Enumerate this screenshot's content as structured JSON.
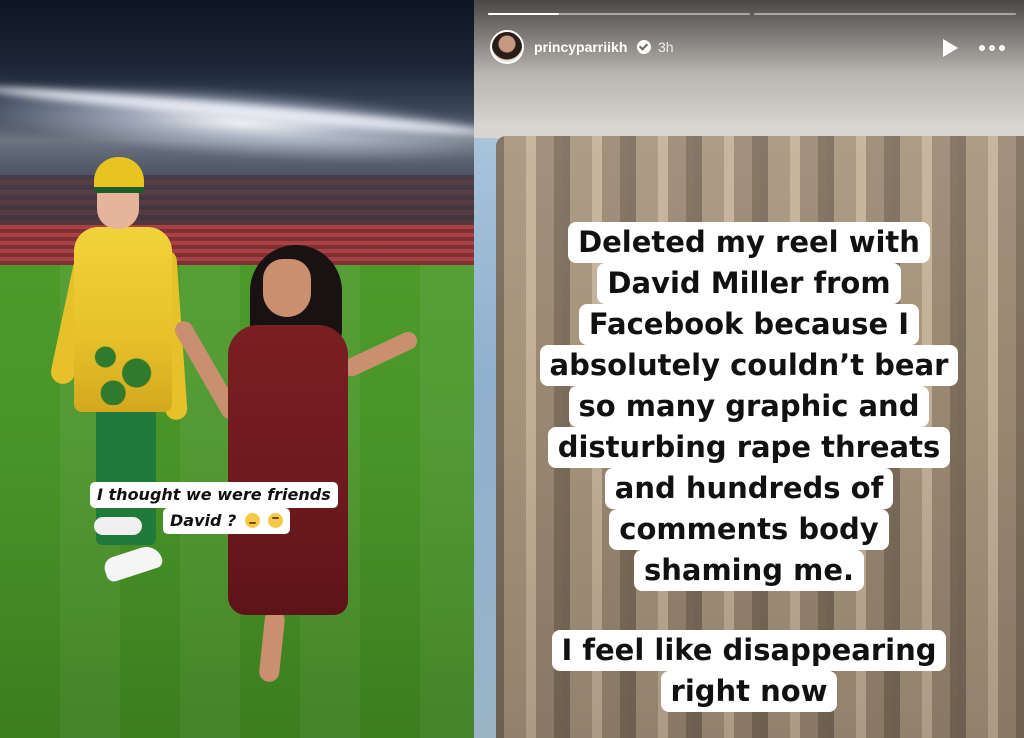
{
  "left_panel": {
    "caption_line1": "I thought we were friends",
    "caption_line2": "David ?",
    "emojis": [
      "slightly-smiling-face-emoji",
      "upside-down-face-emoji"
    ]
  },
  "story": {
    "progress_segments": 2,
    "active_segment": 1,
    "active_progress": 0.27,
    "username": "princyparriikh",
    "verified": true,
    "time": "3h",
    "text_block_1": [
      "Deleted my reel with",
      "David Miller from",
      "Facebook because I",
      "absolutely couldn’t bear",
      "so many graphic and",
      "disturbing rape threats",
      "and hundreds of",
      "comments body",
      "shaming me."
    ],
    "text_block_2": [
      "I feel like disappearing",
      "right now"
    ]
  },
  "icons": {
    "play": "play-icon",
    "more": "more-options-icon",
    "verified": "verified-badge-icon"
  }
}
